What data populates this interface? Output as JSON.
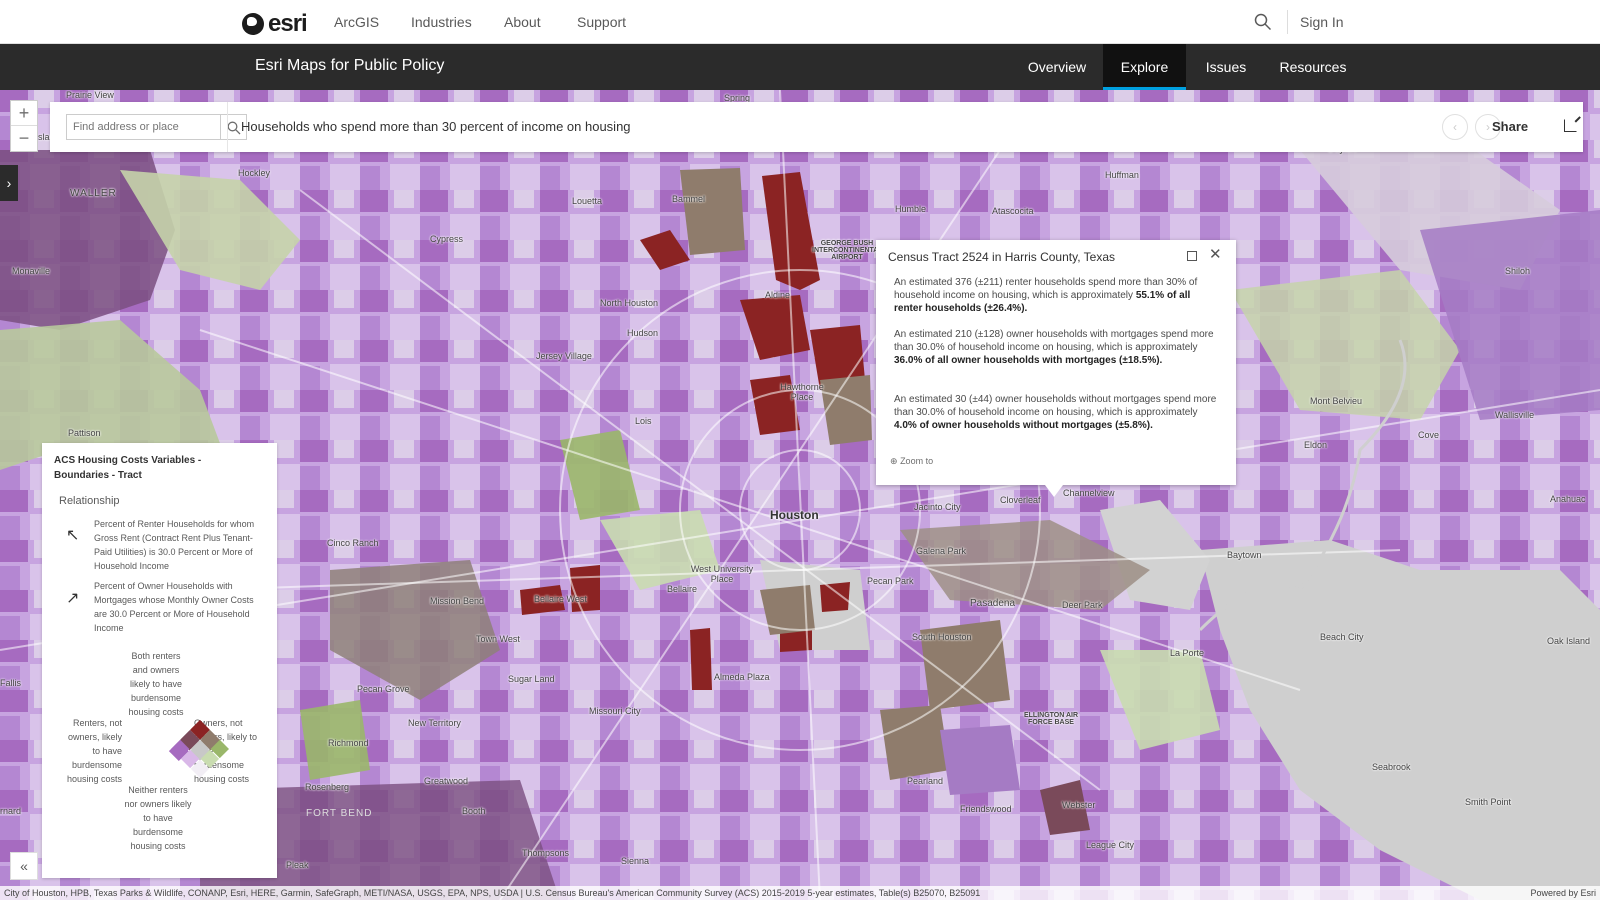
{
  "topnav": {
    "logo_text": "esri",
    "items": [
      "ArcGIS",
      "Industries",
      "About",
      "Support"
    ],
    "sign_in": "Sign In"
  },
  "subnav": {
    "title": "Esri Maps for Public Policy",
    "tabs": [
      "Overview",
      "Explore",
      "Issues",
      "Resources"
    ],
    "active_tab": "Explore"
  },
  "search": {
    "placeholder": "Find address or place"
  },
  "map": {
    "title": "Households who spend more than 30 percent of income on housing",
    "share_label": "Share",
    "places": [
      "Prairie View",
      "Spring",
      "Dayton",
      "Hockley",
      "WALLER",
      "Huffman",
      "Bammel",
      "Humble",
      "Atascocita",
      "Louetta",
      "GEORGE BUSH INTERCONTINENTAL AIRPORT",
      "Monaville",
      "Cypress",
      "Shiloh",
      "Aldine",
      "North Houston",
      "Hudson",
      "Jersey Village",
      "Hawthorne Place",
      "Mont Belvieu",
      "Wallisville",
      "Pattison",
      "Lois",
      "Eldon",
      "Cove",
      "Cloverleaf",
      "Channelview",
      "Jacinto City",
      "Houston",
      "Anahuac",
      "Cinco Ranch",
      "Galena Park",
      "Baytown",
      "West University Place",
      "Bellaire",
      "Pecan Park",
      "Mission Bend",
      "Bellaire West",
      "Pasadena",
      "Deer Park",
      "Town West",
      "South Houston",
      "Beach City",
      "Oak Island",
      "Sugar Land",
      "Almeda Plaza",
      "La Porte",
      "Pecan Grove",
      "Missouri City",
      "New Territory",
      "ELLINGTON AIR FORCE BASE",
      "Richmond",
      "Seabrook",
      "Greatwood",
      "Pearland",
      "Rosenberg",
      "Friendswood",
      "Webster",
      "Smith Point",
      "FORT BEND",
      "Booth",
      "League City",
      "Thompsons",
      "Sienna",
      "Pleak",
      "Fallis",
      "rnard",
      "slan"
    ],
    "zoom_in": "+",
    "zoom_out": "−"
  },
  "legend": {
    "title": "ACS Housing Costs Variables - Boundaries - Tract",
    "subtitle": "Relationship",
    "renter_desc": "Percent of Renter Households for whom Gross Rent (Contract Rent Plus Tenant-Paid Utilities) is 30.0 Percent or More of Household Income",
    "owner_desc": "Percent of Owner Households with Mortgages whose Monthly Owner Costs are 30.0 Percent or More of Household Income",
    "top_label": "Both renters and owners likely to have burdensome housing costs",
    "left_label": "Renters, not owners, likely to have burdensome housing costs",
    "right_label": "Owners, not renters, likely to have burdensome housing costs",
    "bottom_label": "Neither renters nor owners likely to have burdensome housing costs",
    "colors": [
      "#8b2323",
      "#7a4a5a",
      "#a66bc0",
      "#8f7c6c",
      "#c8c8c8",
      "#d9b8e8",
      "#9ab76a",
      "#c9dcb0",
      "#f2eef5"
    ]
  },
  "popup": {
    "title": "Census Tract 2524 in Harris County, Texas",
    "p1_text": "An estimated 376 (±211) renter households spend more than 30% of household income on housing, which is approximately ",
    "p1_bold": "55.1% of all renter households (±26.4%).",
    "p2_text": "An estimated 210 (±128) owner households with mortgages spend more than 30.0% of household income on housing, which is approximately ",
    "p2_bold": "36.0% of all owner households with mortgages (±18.5%).",
    "p3_text": "An estimated 30 (±44) owner households without mortgages spend more than 30.0% of household income on housing, which is approximately ",
    "p3_bold": "4.0% of owner households without mortgages",
    "p3_end": " (±5.8%).",
    "zoom_to": "Zoom to"
  },
  "footer": {
    "attribution": "City of Houston, HPB, Texas Parks & Wildlife, CONANP, Esri, HERE, Garmin, SafeGraph, METI/NASA, USGS, EPA, NPS, USDA | U.S. Census Bureau's American Community Survey (ACS) 2015-2019 5-year estimates, Table(s) B25070, B25091",
    "powered_by": "Powered by Esri"
  }
}
